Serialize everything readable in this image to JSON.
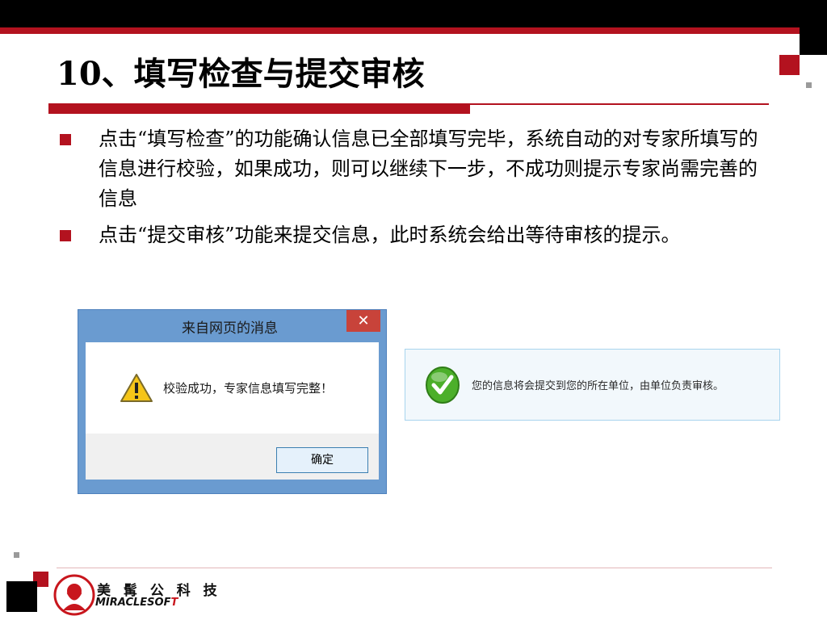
{
  "slide": {
    "title": "10、填写检查与提交审核",
    "bullets": [
      {
        "text": "点击“填写检查”的功能确认信息已全部填写完毕，系统自动的对专家所填写的信息进行校验，如果成功，则可以继续下一步，不成功则提示专家尚需完善的信息"
      },
      {
        "text": "点击“提交审核”功能来提交信息，此时系统会给出等待审核的提示。"
      }
    ]
  },
  "dialog": {
    "title": "来自网页的消息",
    "close_label": "✕",
    "message": "校验成功，专家信息填写完整！",
    "ok_label": "确定"
  },
  "notice": {
    "message": "您的信息将会提交到您的所在单位，由单位负责审核。"
  },
  "logo": {
    "cn": "美 髯 公 科 技",
    "en_main": "MIRACLESOF",
    "en_accent": "T"
  },
  "colors": {
    "accent": "#b3121f",
    "dialog_frame": "#6a9bd0",
    "close": "#c8433a",
    "success": "#4caf2a"
  }
}
